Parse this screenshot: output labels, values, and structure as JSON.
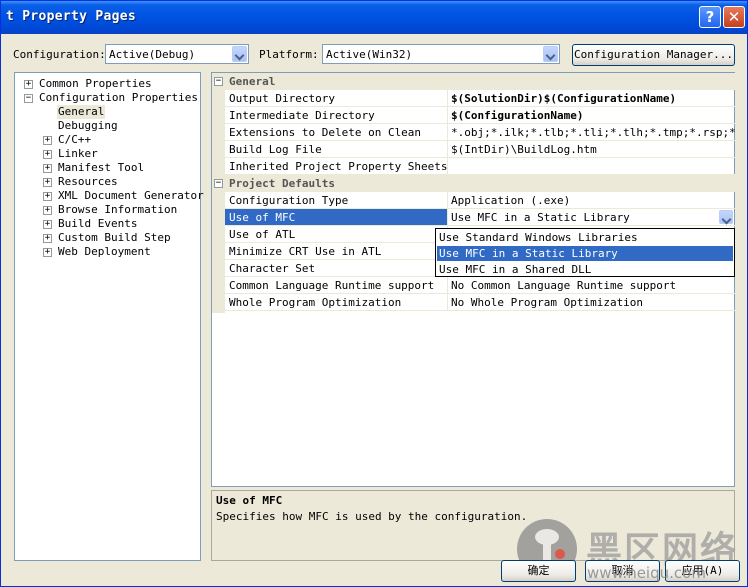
{
  "window": {
    "title": "t Property Pages",
    "help": "?",
    "close": "✕"
  },
  "config": {
    "label": "Configuration:",
    "value": "Active(Debug)",
    "platform_label": "Platform:",
    "platform_value": "Active(Win32)",
    "manager": "Configuration Manager..."
  },
  "tree": {
    "items": [
      {
        "label": "Common Properties",
        "expand": "+"
      },
      {
        "label": "Configuration Properties",
        "expand": "−"
      },
      {
        "label": "General"
      },
      {
        "label": "Debugging"
      },
      {
        "label": "C/C++",
        "expand": "+"
      },
      {
        "label": "Linker",
        "expand": "+"
      },
      {
        "label": "Manifest Tool",
        "expand": "+"
      },
      {
        "label": "Resources",
        "expand": "+"
      },
      {
        "label": "XML Document Generator",
        "expand": "+"
      },
      {
        "label": "Browse Information",
        "expand": "+"
      },
      {
        "label": "Build Events",
        "expand": "+"
      },
      {
        "label": "Custom Build Step",
        "expand": "+"
      },
      {
        "label": "Web Deployment",
        "expand": "+"
      }
    ]
  },
  "grid": {
    "general": {
      "title": "General",
      "rows": [
        {
          "k": "Output Directory",
          "v": "$(SolutionDir)$(ConfigurationName)",
          "bold": true
        },
        {
          "k": "Intermediate Directory",
          "v": "$(ConfigurationName)",
          "bold": true
        },
        {
          "k": "Extensions to Delete on Clean",
          "v": "*.obj;*.ilk;*.tlb;*.tli;*.tlh;*.tmp;*.rsp;*.pgc;*"
        },
        {
          "k": "Build Log File",
          "v": "$(IntDir)\\BuildLog.htm"
        },
        {
          "k": "Inherited Project Property Sheets",
          "v": ""
        }
      ]
    },
    "defaults": {
      "title": "Project Defaults",
      "rows": [
        {
          "k": "Configuration Type",
          "v": "Application (.exe)"
        },
        {
          "k": "Use of MFC",
          "v": "Use MFC in a Static Library"
        },
        {
          "k": "Use of ATL",
          "v": ""
        },
        {
          "k": "Minimize CRT Use in ATL",
          "v": ""
        },
        {
          "k": "Character Set",
          "v": ""
        },
        {
          "k": "Common Language Runtime support",
          "v": "No Common Language Runtime support"
        },
        {
          "k": "Whole Program Optimization",
          "v": "No Whole Program Optimization"
        }
      ]
    },
    "dropdown_options": [
      "Use Standard Windows Libraries",
      "Use MFC in a Static Library",
      "Use MFC in a Shared DLL"
    ]
  },
  "description": {
    "title": "Use of MFC",
    "text": "Specifies how MFC is used by the configuration."
  },
  "buttons": {
    "ok": "确定",
    "cancel": "取消",
    "apply": "应用(A)"
  },
  "watermark": {
    "text": "黑区网络",
    "url": "www.heiqu.com"
  }
}
